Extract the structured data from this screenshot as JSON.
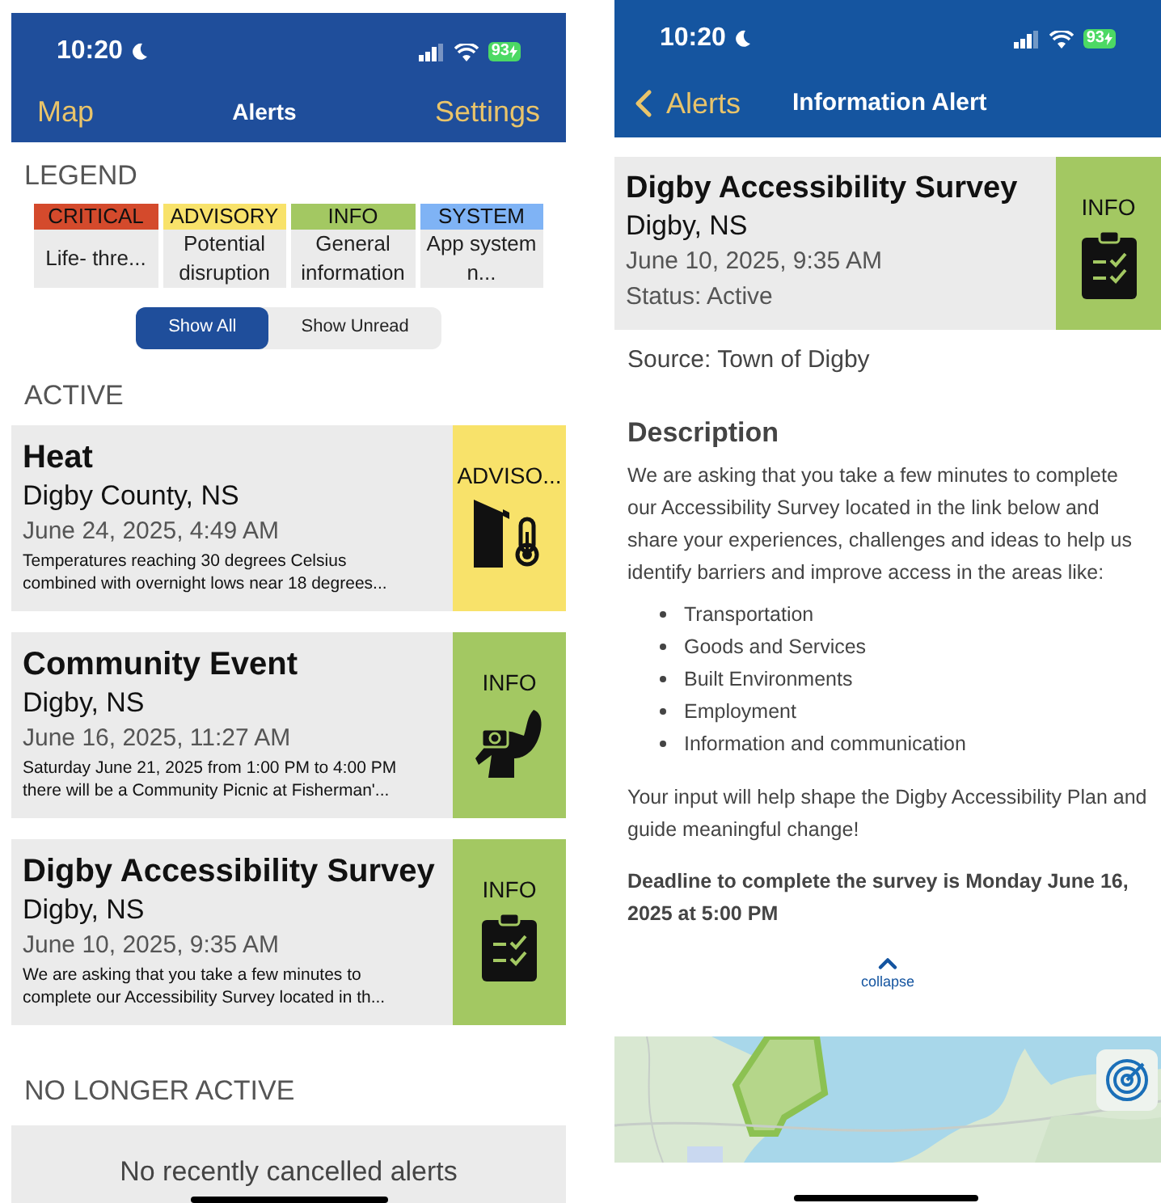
{
  "alerts_screen": {
    "status_bar": {
      "time": "10:20",
      "battery": "93"
    },
    "nav": {
      "left": "Map",
      "title": "Alerts",
      "right": "Settings"
    },
    "legend": {
      "heading": "LEGEND",
      "items": [
        {
          "label": "CRITICAL",
          "text": "Life- thre...",
          "color": "#d44a2c"
        },
        {
          "label": "ADVISORY",
          "text": "Potential disruption",
          "color": "#f8e26a"
        },
        {
          "label": "INFO",
          "text": "General information",
          "color": "#a3c862"
        },
        {
          "label": "SYSTEM",
          "text": "App system n...",
          "color": "#7fb3f5"
        }
      ]
    },
    "filter": [
      {
        "label": "Show All",
        "selected": true
      },
      {
        "label": "Show Unread",
        "selected": false
      }
    ],
    "active": {
      "heading": "ACTIVE",
      "alerts": [
        {
          "kind": "heat",
          "title": "Heat",
          "location": "Digby County, NS",
          "date": "June 24, 2025, 4:49 AM",
          "summary": [
            "Temperatures reaching 30 degrees Celsius",
            "combined with overnight lows near 18 degrees..."
          ],
          "badge": "ADVISO...",
          "color": "#f8e26a"
        },
        {
          "kind": "event",
          "title": "Community Event",
          "location": "Digby, NS",
          "date": "June 16, 2025, 11:27 AM",
          "summary": [
            "Saturday June 21, 2025 from 1:00 PM to 4:00 PM",
            "there will be a Community Picnic at Fisherman'..."
          ],
          "badge": "INFO",
          "color": "#a3c862"
        },
        {
          "kind": "survey",
          "title": "Digby Accessibility Survey",
          "location": "Digby, NS",
          "date": "June 10, 2025, 9:35 AM",
          "summary": [
            "We are asking that you take a few minutes to",
            "complete our Accessibility Survey located in th..."
          ],
          "badge": "INFO",
          "color": "#a3c862"
        }
      ]
    },
    "no_longer_active": {
      "heading": "NO LONGER ACTIVE",
      "empty_text": "No recently cancelled alerts"
    }
  },
  "detail_screen": {
    "status_bar": {
      "time": "10:20",
      "battery": "93"
    },
    "nav": {
      "back": "Alerts",
      "title": "Information Alert"
    },
    "alert": {
      "kind": "survey",
      "title": "Digby Accessibility Survey",
      "location": "Digby, NS",
      "date": "June 10, 2025, 9:35 AM",
      "status": "Status: Active",
      "badge": "INFO",
      "color": "#a3c862"
    },
    "source": "Source: Town of Digby",
    "description": {
      "heading": "Description",
      "intro": "We are asking that you take a few minutes to complete our Accessibility Survey located in the link below and share your experiences, challenges and ideas to help us identify barriers and improve access in the areas like:",
      "bullets": [
        "Transportation",
        "Goods and Services",
        "Built Environments",
        "Employment",
        "Information and communication"
      ],
      "closing": "Your input will help shape the Digby Accessibility Plan and guide meaningful change!",
      "deadline": "Deadline to complete the survey is Monday June 16, 2025 at 5:00 PM"
    },
    "collapse": "collapse"
  }
}
